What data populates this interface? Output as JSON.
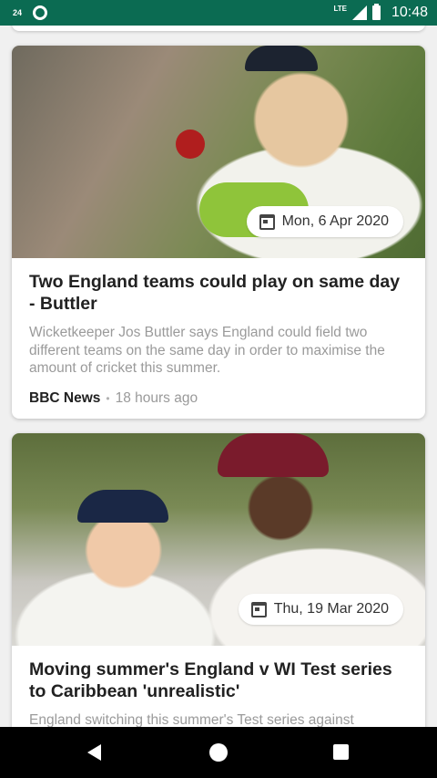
{
  "status_bar": {
    "notification_count": "24",
    "network": "LTE",
    "time": "10:48"
  },
  "articles": [
    {
      "date": "Mon, 6 Apr 2020",
      "title": "Two England teams could play on same day - Buttler",
      "description": "Wicketkeeper Jos Buttler says England could field two different teams on the same day in order to maximise the amount of cricket this summer.",
      "source": "BBC News",
      "time_ago": "18 hours ago"
    },
    {
      "date": "Thu, 19 Mar 2020",
      "title": "Moving summer's England v WI Test series to Caribbean 'unrealistic'",
      "description": "England switching this summer's Test series against"
    }
  ],
  "icons": {
    "calendar": "calendar-icon",
    "back": "back-icon",
    "home": "home-icon",
    "recents": "recents-icon"
  },
  "colors": {
    "status_bar": "#0b6b52",
    "nav_bar": "#000000"
  }
}
